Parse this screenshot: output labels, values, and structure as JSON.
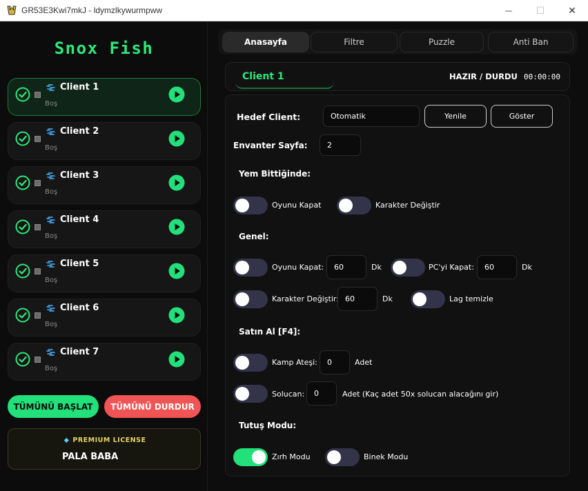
{
  "window": {
    "title": "GR53E3Kwi7mkJ - ldymzlkywurmpww",
    "icons": {
      "app": "app-logo-icon",
      "minimize": "minimize-icon",
      "maximize": "maximize-icon",
      "close": "close-icon"
    },
    "minimize_glyph": "—",
    "maximize_glyph": "☐",
    "close_glyph": "✕"
  },
  "colors": {
    "accent_green": "#22e07a",
    "danger_red": "#f05454",
    "gold": "#e8d36a",
    "panel_bg": "#111111"
  },
  "sidebar": {
    "logo": "Snox Fish",
    "clients": [
      {
        "name": "Client 1",
        "status": "Boş",
        "active": true
      },
      {
        "name": "Client 2",
        "status": "Boş",
        "active": false
      },
      {
        "name": "Client 3",
        "status": "Boş",
        "active": false
      },
      {
        "name": "Client 4",
        "status": "Boş",
        "active": false
      },
      {
        "name": "Client 5",
        "status": "Boş",
        "active": false
      },
      {
        "name": "Client 6",
        "status": "Boş",
        "active": false
      },
      {
        "name": "Client 7",
        "status": "Boş",
        "active": false
      }
    ],
    "start_all": "TÜMÜNÜ BAŞLAT",
    "stop_all": "TÜMÜNÜ DURDUR",
    "license": {
      "label": "PREMIUM LICENSE",
      "owner": "PALA BABA",
      "diamond": "◆"
    }
  },
  "tabs": [
    {
      "label": "Anasayfa",
      "active": true
    },
    {
      "label": "Filtre",
      "active": false
    },
    {
      "label": "Puzzle",
      "active": false
    },
    {
      "label": "Anti Ban",
      "active": false
    }
  ],
  "client_header": {
    "client": "Client 1",
    "state": "HAZIR / DURDU",
    "timer": "00:00:00"
  },
  "form": {
    "target_client_label": "Hedef Client:",
    "target_client_value": "Otomatik",
    "refresh_button": "Yenile",
    "show_button": "Göster",
    "inventory_page_label": "Envanter Sayfa:",
    "inventory_page_value": "2",
    "bait_section": "Yem Bittiğinde:",
    "bait_close_game": {
      "label": "Oyunu Kapat",
      "on": false
    },
    "bait_change_char": {
      "label": "Karakter Değiştir",
      "on": false
    },
    "general_section": "Genel:",
    "close_game": {
      "label": "Oyunu Kapat:",
      "on": false,
      "value": "60",
      "unit": "Dk"
    },
    "close_pc": {
      "label": "PC'yi Kapat:",
      "on": false,
      "value": "60",
      "unit": "Dk"
    },
    "change_char": {
      "label": "Karakter Değiştir:",
      "on": false,
      "value": "60",
      "unit": "Dk"
    },
    "lag_clean": {
      "label": "Lag temizle",
      "on": false
    },
    "buy_section": "Satın Al [F4]:",
    "campfire": {
      "label": "Kamp Ateşi:",
      "on": false,
      "value": "0",
      "unit": "Adet"
    },
    "worm": {
      "label": "Solucan:",
      "on": false,
      "value": "0",
      "unit": "Adet (Kaç adet 50x solucan alacağını gir)"
    },
    "grip_section": "Tutuş Modu:",
    "armor_mode": {
      "label": "Zırh Modu",
      "on": true
    },
    "mount_mode": {
      "label": "Binek Modu",
      "on": false
    }
  }
}
